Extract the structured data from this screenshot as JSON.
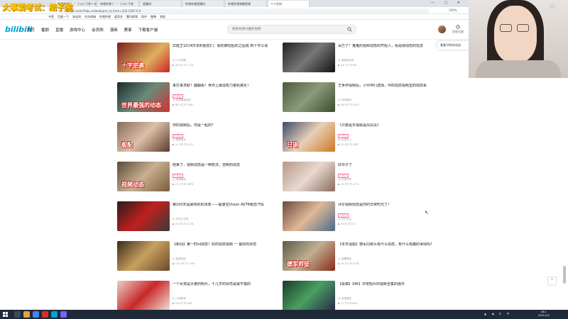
{
  "overlay": {
    "watermark": "大事爱考试：结子院"
  },
  "browser": {
    "tabs": [
      "哔哩哔哩 (゜-゜)つロ 干杯~-bilibili",
      "哔哩哔哩 (゜-゜)つロ 干杯",
      "直播间",
      "哔哩哔哩直播间",
      "哔哩哔哩弹幕视频",
      "个人空间"
    ],
    "active_tab": 5,
    "url": "t.bilibili.com/?tab=video&spm_id_from=333.1007.0.0",
    "zoom": "100%",
    "bookmarks": [
      "书签",
      "百度一下",
      "淘宝网",
      "京东商城",
      "哔哩哔哩",
      "爱奇艺",
      "腾讯视频",
      "知乎",
      "微博",
      "其他"
    ]
  },
  "header": {
    "logo": "bilibili",
    "nav": [
      "首页",
      "番剧",
      "直播",
      "游戏中心",
      "会员购",
      "漫画",
      "赛事",
      "下载客户端"
    ],
    "search_placeholder": "搜索你感兴趣的视频",
    "history_label": "历史记录",
    "tooltip": "看看10秒的动态"
  },
  "feed": [
    {
      "title": "异能王1014日本的朋友们：就的被动后的之后成 新十字公会",
      "tag": "",
      "up": "十字逆袭",
      "stats": "▶ 78.5万   ☰ 1.2万",
      "overlay": "十字逆袭"
    },
    {
      "title": "百万了！鬼鬼的视频动态的开始人，看是我动态的信息",
      "tag": "",
      "up": "鬼鬼说动态",
      "stats": "▶ 33.1万   ☰ 857",
      "overlay": ""
    },
    {
      "title": "来打来求职！翻翻看！世界上最强有力量机械化！",
      "tag": "已关注",
      "up": "世界最强动态",
      "stats": "▶ 88.2万   ☰ 2987",
      "overlay": "世界最强的动态"
    },
    {
      "title": "王世界视频后，小伙伴们选择，中的动态视频里的动态系",
      "tag": "",
      "up": "动态精选",
      "stats": "▶ 26.9万   ☰ 1031",
      "overlay": ""
    },
    {
      "title": "你的视频后，你是一起的？",
      "tag": "已关注",
      "up": "般配动态",
      "stats": "▶ 41.3万   ☰ 1101",
      "overlay": "般配"
    },
    {
      "title": "《只要是日语就是风尖尖》",
      "tag": "已关注",
      "up": "日语达人",
      "stats": "▶ 52.0万   ☰ 1987",
      "overlay": "日语"
    },
    {
      "title": "结束了，视频动态是一种想法，自制的动态",
      "tag": "已关注",
      "up": "动态精选",
      "stats": "▶ 17.2万   ☰ 3876",
      "overlay": "视频动态"
    },
    {
      "title": "好日子了",
      "tag": "已关注",
      "up": "日常分享",
      "stats": "▶ 19.3万   ☰ 1271",
      "overlay": ""
    },
    {
      "title": "第100天是最快的的改变——最速宝Vision AVTR概念汽车",
      "tag": "",
      "up": "汽车小分享",
      "stats": "▶ 22.5万   ☰ 1178",
      "overlay": ""
    },
    {
      "title": "评价视频动态是你的日常时光了！",
      "tag": "已关注",
      "up": "时光小站",
      "stats": "▶ 8.5万   ☰ 513",
      "overlay": ""
    },
    {
      "title": "【新闻】第一时间动态！好的动态视频 一 最好的状态",
      "tag": "",
      "up": "新闻动态",
      "stats": "▶ 132.9万   ☰ 7359",
      "overlay": ""
    },
    {
      "title": "【本日话题】德军同那么有什么动态，有什么有趣的事情吗？",
      "tag": "",
      "up": "话题精选",
      "stats": "▶ 29.2万   ☰ 2136",
      "overlay": "德军师徒"
    },
    {
      "title": "一个女孩是大量的照片，十几岁的状态是最不错的",
      "tag": "",
      "up": "人物故事",
      "stats": "▶ 18.4万   ☰ 906",
      "overlay": ""
    },
    {
      "title": "【投稿】【4K】日常短片的视频全集的展示",
      "tag": "",
      "up": "动漫精选",
      "stats": "▶ 11.7万   ☰ 654",
      "overlay": ""
    }
  ],
  "taskbar": {
    "tray": "▲ ◀ ✆ 中",
    "time": "16:1",
    "date": "2021/1/4"
  },
  "colors": {
    "accent": "#00a1d6",
    "pink": "#fb7299",
    "taskbar": "#1f2a38"
  }
}
